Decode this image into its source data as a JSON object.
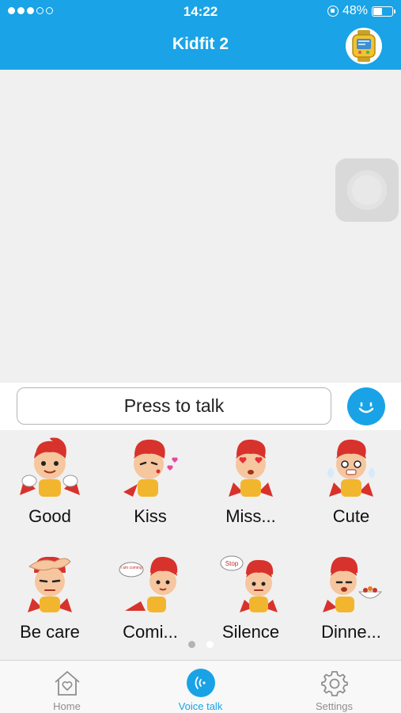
{
  "status_bar": {
    "time": "14:22",
    "battery_percent": "48%",
    "battery_level": 0.48,
    "signal_bars_filled": 3,
    "signal_bars_total": 5
  },
  "header": {
    "title": "Kidfit 2",
    "avatar_icon": "smartwatch-icon"
  },
  "input": {
    "press_to_talk": "Press to talk",
    "emoji_icon": "smiley-face-icon"
  },
  "stickers": [
    {
      "label": "Good",
      "icon": "hero-thumbs-up-sticker"
    },
    {
      "label": "Kiss",
      "icon": "hero-kiss-sticker"
    },
    {
      "label": "Miss...",
      "icon": "hero-heart-eyes-sticker"
    },
    {
      "label": "Cute",
      "icon": "hero-cute-sticker"
    },
    {
      "label": "Be care",
      "icon": "hero-be-careful-sticker"
    },
    {
      "label": "Comi...",
      "icon": "hero-coming-sticker"
    },
    {
      "label": "Silence",
      "icon": "hero-stop-sticker"
    },
    {
      "label": "Dinne...",
      "icon": "hero-dinner-sticker"
    }
  ],
  "sticker_bubbles": {
    "coming": "I am coming",
    "stop": "Stop"
  },
  "pager": {
    "pages": 2,
    "current": 1
  },
  "tabs": [
    {
      "label": "Home",
      "icon": "house-heart-icon",
      "active": false
    },
    {
      "label": "Voice talk",
      "icon": "voice-waves-icon",
      "active": true
    },
    {
      "label": "Settings",
      "icon": "gear-icon",
      "active": false
    }
  ],
  "colors": {
    "accent": "#1aa3e6",
    "background": "#f0f0f0",
    "sticker_red": "#d8322c",
    "sticker_skin": "#f6c69f",
    "tab_inactive": "#8e8e8e"
  }
}
